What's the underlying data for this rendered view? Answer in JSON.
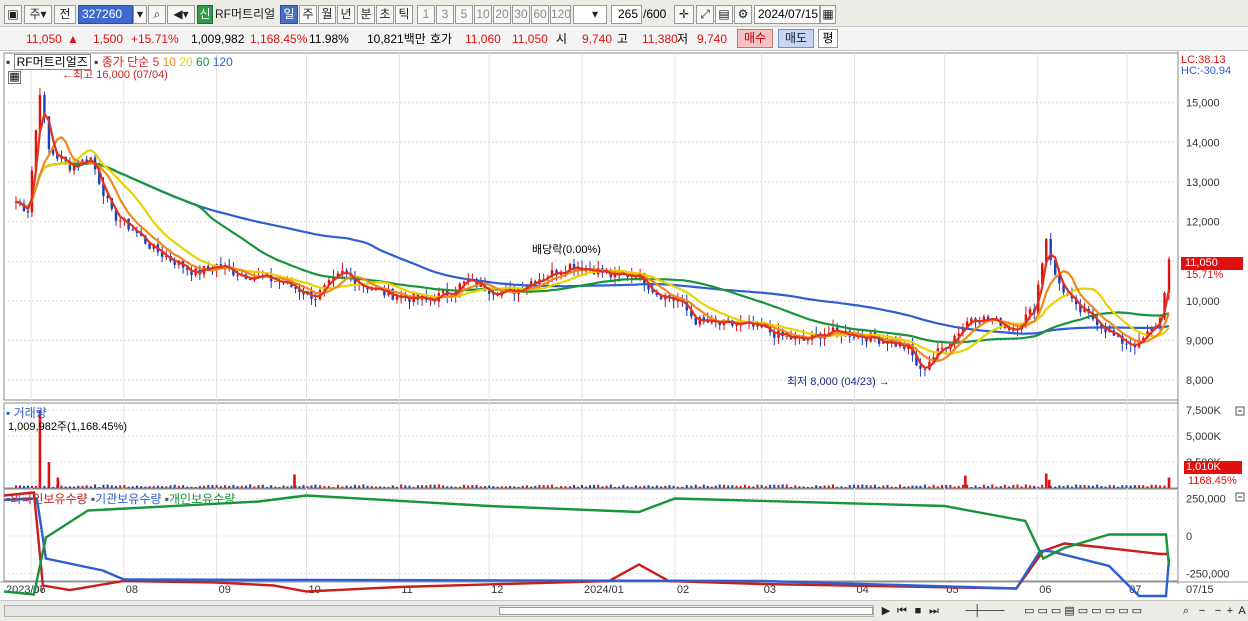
{
  "toolbar": {
    "period_type": "주",
    "full_label": "전",
    "stock_code": "327260",
    "badge_new": "신",
    "stock_name": "RF머트리얼",
    "periods": [
      "일",
      "주",
      "월",
      "년",
      "분",
      "초",
      "틱"
    ],
    "selected_period": "일",
    "intervals": [
      "1",
      "3",
      "5",
      "10",
      "20",
      "30",
      "60",
      "120"
    ],
    "count": "265",
    "count_total": "/600",
    "date": "2024/07/15"
  },
  "quote": {
    "price": "11,050",
    "change_arrow": "▲",
    "change": "1,500",
    "change_pct": "+15.71%",
    "volume": "1,009,982",
    "volume_ratio": "1,168.45%",
    "turnover": "11.98%",
    "trade_value": "10,821백만",
    "ask_label": "호가",
    "ask": "11,060",
    "bid": "11,050",
    "open_label": "시",
    "open": "9,740",
    "high_label": "고",
    "high": "11,380",
    "low_label": "저",
    "low": "9,740",
    "buy_label": "매수",
    "sell_label": "매도",
    "avg_label": "평"
  },
  "chart_data": {
    "type": "candlestick",
    "title": "RF머트리얼즈",
    "ma_legend": {
      "label": "종가 단순",
      "periods": [
        {
          "period": "5",
          "color": "#e0321e"
        },
        {
          "period": "10",
          "color": "#f08a1e"
        },
        {
          "period": "20",
          "color": "#e8d200"
        },
        {
          "period": "60",
          "color": "#18943a"
        },
        {
          "period": "120",
          "color": "#2d5fd0"
        }
      ]
    },
    "price_axis": [
      "15,000",
      "14,000",
      "13,000",
      "12,000",
      "11,000",
      "10,000",
      "9,000",
      "8,000"
    ],
    "ylim": [
      7500,
      16100
    ],
    "annotations": {
      "high": "최고 16,000 (07/04)",
      "low": "최저 8,000 (04/23)",
      "dividend": "배당락(0.00%)",
      "current_price": "11,050",
      "current_pct": "15.71%",
      "lc": "LC:38.13",
      "hc": "HC:-30.94"
    },
    "months": [
      "2023/06",
      "07",
      "08",
      "09",
      "10",
      "11",
      "12",
      "2024/01",
      "02",
      "03",
      "04",
      "05",
      "06",
      "07",
      "07/15"
    ],
    "close_series": [
      [
        "2023-06-26",
        12500
      ],
      [
        "2023-06-30",
        12300
      ],
      [
        "2023-07-04",
        15300
      ],
      [
        "2023-07-07",
        13800
      ],
      [
        "2023-07-14",
        13400
      ],
      [
        "2023-07-21",
        13600
      ],
      [
        "2023-07-28",
        12200
      ],
      [
        "2023-08-04",
        11800
      ],
      [
        "2023-08-11",
        11300
      ],
      [
        "2023-08-18",
        11000
      ],
      [
        "2023-08-25",
        10700
      ],
      [
        "2023-09-01",
        10900
      ],
      [
        "2023-09-08",
        10700
      ],
      [
        "2023-09-15",
        10600
      ],
      [
        "2023-09-22",
        10500
      ],
      [
        "2023-10-04",
        10100
      ],
      [
        "2023-10-13",
        10700
      ],
      [
        "2023-10-20",
        10400
      ],
      [
        "2023-10-27",
        10200
      ],
      [
        "2023-11-03",
        10100
      ],
      [
        "2023-11-10",
        10000
      ],
      [
        "2023-11-17",
        10200
      ],
      [
        "2023-11-24",
        10500
      ],
      [
        "2023-12-01",
        10300
      ],
      [
        "2023-12-08",
        10200
      ],
      [
        "2023-12-15",
        10500
      ],
      [
        "2023-12-22",
        10700
      ],
      [
        "2023-12-28",
        10900
      ],
      [
        "2024-01-05",
        10800
      ],
      [
        "2024-01-12",
        10600
      ],
      [
        "2024-01-19",
        10700
      ],
      [
        "2024-01-26",
        10200
      ],
      [
        "2024-02-02",
        10000
      ],
      [
        "2024-02-08",
        9500
      ],
      [
        "2024-02-16",
        9400
      ],
      [
        "2024-02-23",
        9400
      ],
      [
        "2024-03-01",
        9300
      ],
      [
        "2024-03-08",
        9100
      ],
      [
        "2024-03-15",
        9000
      ],
      [
        "2024-03-22",
        9200
      ],
      [
        "2024-03-29",
        9200
      ],
      [
        "2024-04-05",
        9100
      ],
      [
        "2024-04-12",
        9000
      ],
      [
        "2024-04-19",
        8800
      ],
      [
        "2024-04-23",
        8200
      ],
      [
        "2024-04-26",
        8500
      ],
      [
        "2024-05-03",
        9000
      ],
      [
        "2024-05-10",
        9600
      ],
      [
        "2024-05-17",
        9500
      ],
      [
        "2024-05-24",
        9300
      ],
      [
        "2024-05-31",
        9800
      ],
      [
        "2024-06-04",
        11600
      ],
      [
        "2024-06-07",
        10600
      ],
      [
        "2024-06-14",
        9800
      ],
      [
        "2024-06-21",
        9500
      ],
      [
        "2024-06-28",
        9000
      ],
      [
        "2024-07-05",
        8900
      ],
      [
        "2024-07-12",
        9550
      ],
      [
        "2024-07-15",
        11050
      ]
    ],
    "volume_panel": {
      "title": "거래량",
      "value": "1,009,982주(1,168.45%)",
      "axis": [
        "7,500K",
        "5,000K",
        "2,500K"
      ],
      "current": "1,010K",
      "current_pct": "1168.45%",
      "spikes": [
        [
          "2023-07-04",
          7500
        ],
        [
          "2023-07-07",
          2500
        ],
        [
          "2023-07-10",
          1000
        ],
        [
          "2023-09-27",
          1300
        ],
        [
          "2024-05-08",
          1200
        ],
        [
          "2024-06-04",
          1400
        ],
        [
          "2024-06-05",
          800
        ],
        [
          "2024-07-15",
          1010
        ]
      ]
    },
    "holding_panel": {
      "titles": [
        "외국인보유수량",
        "기관보유수량",
        "개인보유수량"
      ],
      "colors": [
        "#c81e1e",
        "#2d5fd0",
        "#18943a"
      ],
      "axis": [
        "250,000",
        "0",
        "-250,000"
      ]
    }
  },
  "bottom": {
    "icons": [
      "play-icon",
      "fast-forward-icon",
      "stop-icon",
      "end-icon",
      "zoom-in-icon",
      "zoom-out-icon",
      "plus-icon",
      "text-icon"
    ]
  }
}
